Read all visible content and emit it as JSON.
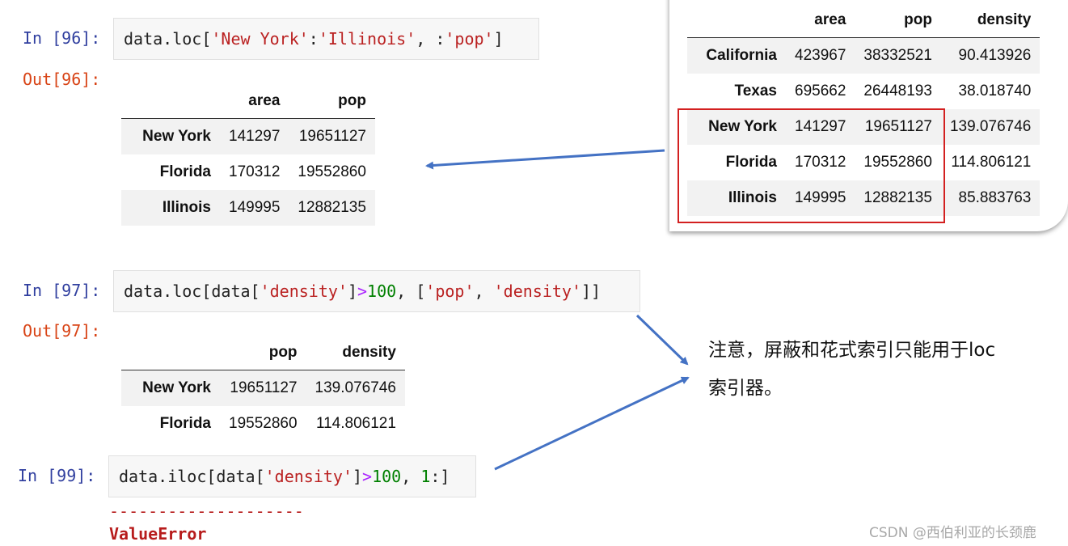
{
  "colors": {
    "prompt_in": "#303f9f",
    "prompt_out": "#d84315",
    "string": "#ba2121",
    "number": "#008000",
    "operator": "#aa22ff",
    "arrow": "#4472c4",
    "highlight_box": "#d32020",
    "error": "#b71c1c"
  },
  "cell96": {
    "in_prompt": "In [96]:",
    "out_prompt": "Out[96]:",
    "code": {
      "t1": "data.loc[",
      "t2": "'New York'",
      "t3": ":",
      "t4": "'Illinois'",
      "t5": ", :",
      "t6": "'pop'",
      "t7": "]"
    },
    "table": {
      "columns": [
        "area",
        "pop"
      ],
      "rows": [
        {
          "index": "New York",
          "values": [
            "141297",
            "19651127"
          ]
        },
        {
          "index": "Florida",
          "values": [
            "170312",
            "19552860"
          ]
        },
        {
          "index": "Illinois",
          "values": [
            "149995",
            "12882135"
          ]
        }
      ]
    }
  },
  "source_table": {
    "columns": [
      "area",
      "pop",
      "density"
    ],
    "rows": [
      {
        "index": "California",
        "values": [
          "423967",
          "38332521",
          "90.413926"
        ]
      },
      {
        "index": "Texas",
        "values": [
          "695662",
          "26448193",
          "38.018740"
        ]
      },
      {
        "index": "New York",
        "values": [
          "141297",
          "19651127",
          "139.076746"
        ]
      },
      {
        "index": "Florida",
        "values": [
          "170312",
          "19552860",
          "114.806121"
        ]
      },
      {
        "index": "Illinois",
        "values": [
          "149995",
          "12882135",
          "85.883763"
        ]
      }
    ]
  },
  "cell97": {
    "in_prompt": "In [97]:",
    "out_prompt": "Out[97]:",
    "code": {
      "t1": "data.loc[data[",
      "t2": "'density'",
      "t3": "]",
      "t4": ">",
      "t5": "100",
      "t6": ", [",
      "t7": "'pop'",
      "t8": ", ",
      "t9": "'density'",
      "t10": "]]"
    },
    "table": {
      "columns": [
        "pop",
        "density"
      ],
      "rows": [
        {
          "index": "New York",
          "values": [
            "19651127",
            "139.076746"
          ]
        },
        {
          "index": "Florida",
          "values": [
            "19552860",
            "114.806121"
          ]
        }
      ]
    }
  },
  "cell99": {
    "in_prompt": "In [99]:",
    "code": {
      "t1": "data.iloc[data[",
      "t2": "'density'",
      "t3": "]",
      "t4": ">",
      "t5": "100",
      "t6": ", ",
      "t7": "1",
      "t8": ":]"
    },
    "error_dashes": "--------------------",
    "error_name": "ValueError"
  },
  "annotation": {
    "line1": "注意，屏蔽和花式索引只能用于loc",
    "line2": "索引器。"
  },
  "watermark": "CSDN @西伯利亚的长颈鹿"
}
